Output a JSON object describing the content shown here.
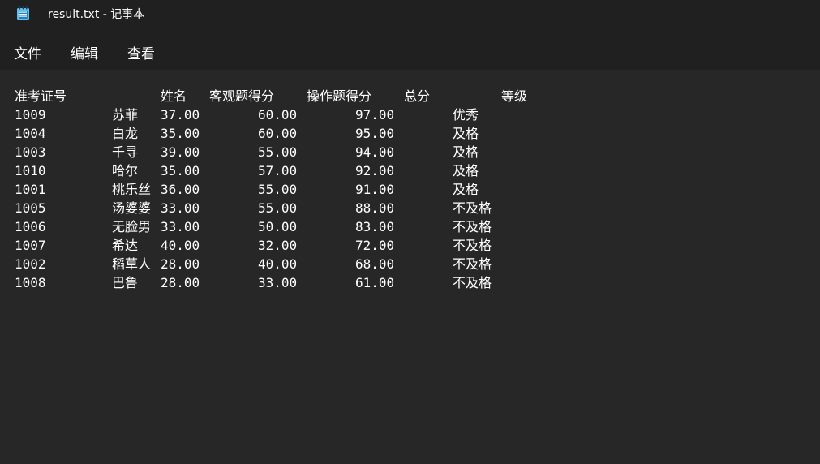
{
  "window": {
    "title": "result.txt - 记事本",
    "icon": "notepad-icon"
  },
  "menu": {
    "items": [
      {
        "label": "文件"
      },
      {
        "label": "编辑"
      },
      {
        "label": "查看"
      }
    ]
  },
  "table": {
    "headers": [
      "准考证号",
      "姓名",
      "客观题得分",
      "操作题得分",
      "总分",
      "等级"
    ],
    "rows": [
      [
        "1009",
        "苏菲",
        "37.00",
        "60.00",
        "97.00",
        "优秀"
      ],
      [
        "1004",
        "白龙",
        "35.00",
        "60.00",
        "95.00",
        "及格"
      ],
      [
        "1003",
        "千寻",
        "39.00",
        "55.00",
        "94.00",
        "及格"
      ],
      [
        "1010",
        "哈尔",
        "35.00",
        "57.00",
        "92.00",
        "及格"
      ],
      [
        "1001",
        "桃乐丝",
        "36.00",
        "55.00",
        "91.00",
        "及格"
      ],
      [
        "1005",
        "汤婆婆",
        "33.00",
        "55.00",
        "88.00",
        "不及格"
      ],
      [
        "1006",
        "无脸男",
        "33.00",
        "50.00",
        "83.00",
        "不及格"
      ],
      [
        "1007",
        "希达",
        "40.00",
        "32.00",
        "72.00",
        "不及格"
      ],
      [
        "1002",
        "稻草人",
        "28.00",
        "40.00",
        "68.00",
        "不及格"
      ],
      [
        "1008",
        "巴鲁",
        "28.00",
        "33.00",
        "61.00",
        "不及格"
      ]
    ]
  },
  "colors": {
    "background": "#272727",
    "chrome": "#202020",
    "text": "#ffffff"
  }
}
